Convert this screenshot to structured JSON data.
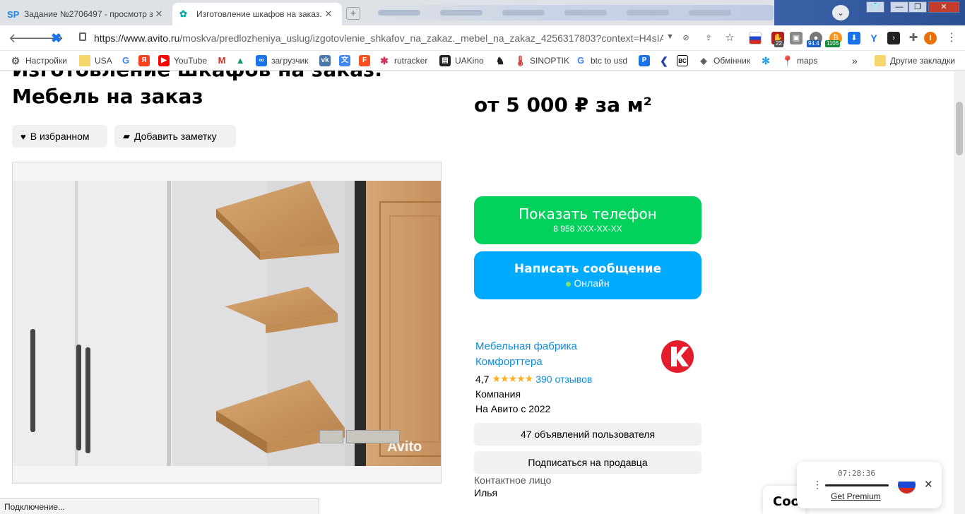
{
  "browser": {
    "tabs": [
      {
        "favicon": "SP",
        "title": "Задание №2706497 - просмотр з"
      },
      {
        "favicon": "leaf-icon",
        "title": "Изготовление шкафов на заказ. М"
      }
    ],
    "url_host": "https://www.avito.ru",
    "url_path": "/moskva/predlozheniya_uslug/izgotovlenie_shkafov_na_zakaz._mebel_na_zakaz_4256317803?context=H4sIA...",
    "extension_badges": {
      "ext1": "22",
      "ext2": "94.4",
      "ext3": "1106"
    },
    "profile_initial": "I",
    "window_controls": {
      "minimize": "—",
      "restore": "❐",
      "close": "✕"
    }
  },
  "bookmarks": [
    {
      "label": "Настройки",
      "icon": "gear-icon"
    },
    {
      "label": "USA",
      "icon": "folder-icon"
    },
    {
      "label": "",
      "icon": "google-icon"
    },
    {
      "label": "",
      "icon": "yandex-icon"
    },
    {
      "label": "YouTube",
      "icon": "youtube-icon"
    },
    {
      "label": "",
      "icon": "gmail-icon"
    },
    {
      "label": "",
      "icon": "drive-icon"
    },
    {
      "label": "загрузчик",
      "icon": "loop-icon"
    },
    {
      "label": "",
      "icon": "vk-icon"
    },
    {
      "label": "",
      "icon": "translate-icon"
    },
    {
      "label": "",
      "icon": "f-icon"
    },
    {
      "label": "rutracker",
      "icon": "rutracker-icon"
    },
    {
      "label": "UAKino",
      "icon": "uakino-icon"
    },
    {
      "label": "",
      "icon": "chess-icon"
    },
    {
      "label": "SINOPTIK",
      "icon": "thermometer-icon"
    },
    {
      "label": "btc to usd",
      "icon": "google-icon"
    },
    {
      "label": "",
      "icon": "p-icon"
    },
    {
      "label": "",
      "icon": "arrow-icon"
    },
    {
      "label": "",
      "icon": "bc-icon"
    },
    {
      "label": "Обмінник",
      "icon": "exchange-icon"
    },
    {
      "label": "",
      "icon": "snowflake-icon"
    },
    {
      "label": "maps",
      "icon": "maps-icon"
    }
  ],
  "bookmarks_more": "»",
  "other_bookmarks": "Другие закладки",
  "listing": {
    "title_line1": "Изготовление шкафов на заказ.",
    "title_line2": "Мебель на заказ",
    "favorite_label": "В избранном",
    "note_label": "Добавить заметку",
    "price": "от 5 000 ₽ за м²",
    "watermark": "Avito"
  },
  "actions": {
    "show_phone": "Показать телефон",
    "phone_masked": "8 958 XXX-XX-XX",
    "write_message": "Написать сообщение",
    "online_status": "Онлайн"
  },
  "seller": {
    "name_line1": "Мебельная фабрика",
    "name_line2": "Комфорттера",
    "rating": "4,7",
    "stars": "★★★★★",
    "reviews": "390 отзывов",
    "type": "Компания",
    "since": "На Авито с 2022",
    "ads_button": "47 объявлений пользователя",
    "subscribe_button": "Подписаться на продавца",
    "contact_label": "Контактное лицо",
    "contact_name": "Илья",
    "logo_letter": "К"
  },
  "widget": {
    "partial_text": "Coo",
    "time": "07:28:36",
    "premium_link": "Get Premium"
  },
  "status_text": "Подключение...",
  "colors": {
    "green": "#02d15c",
    "blue": "#00aaff",
    "link": "#0a8de0",
    "star": "#ffb021",
    "logo_red": "#e41d2c"
  }
}
